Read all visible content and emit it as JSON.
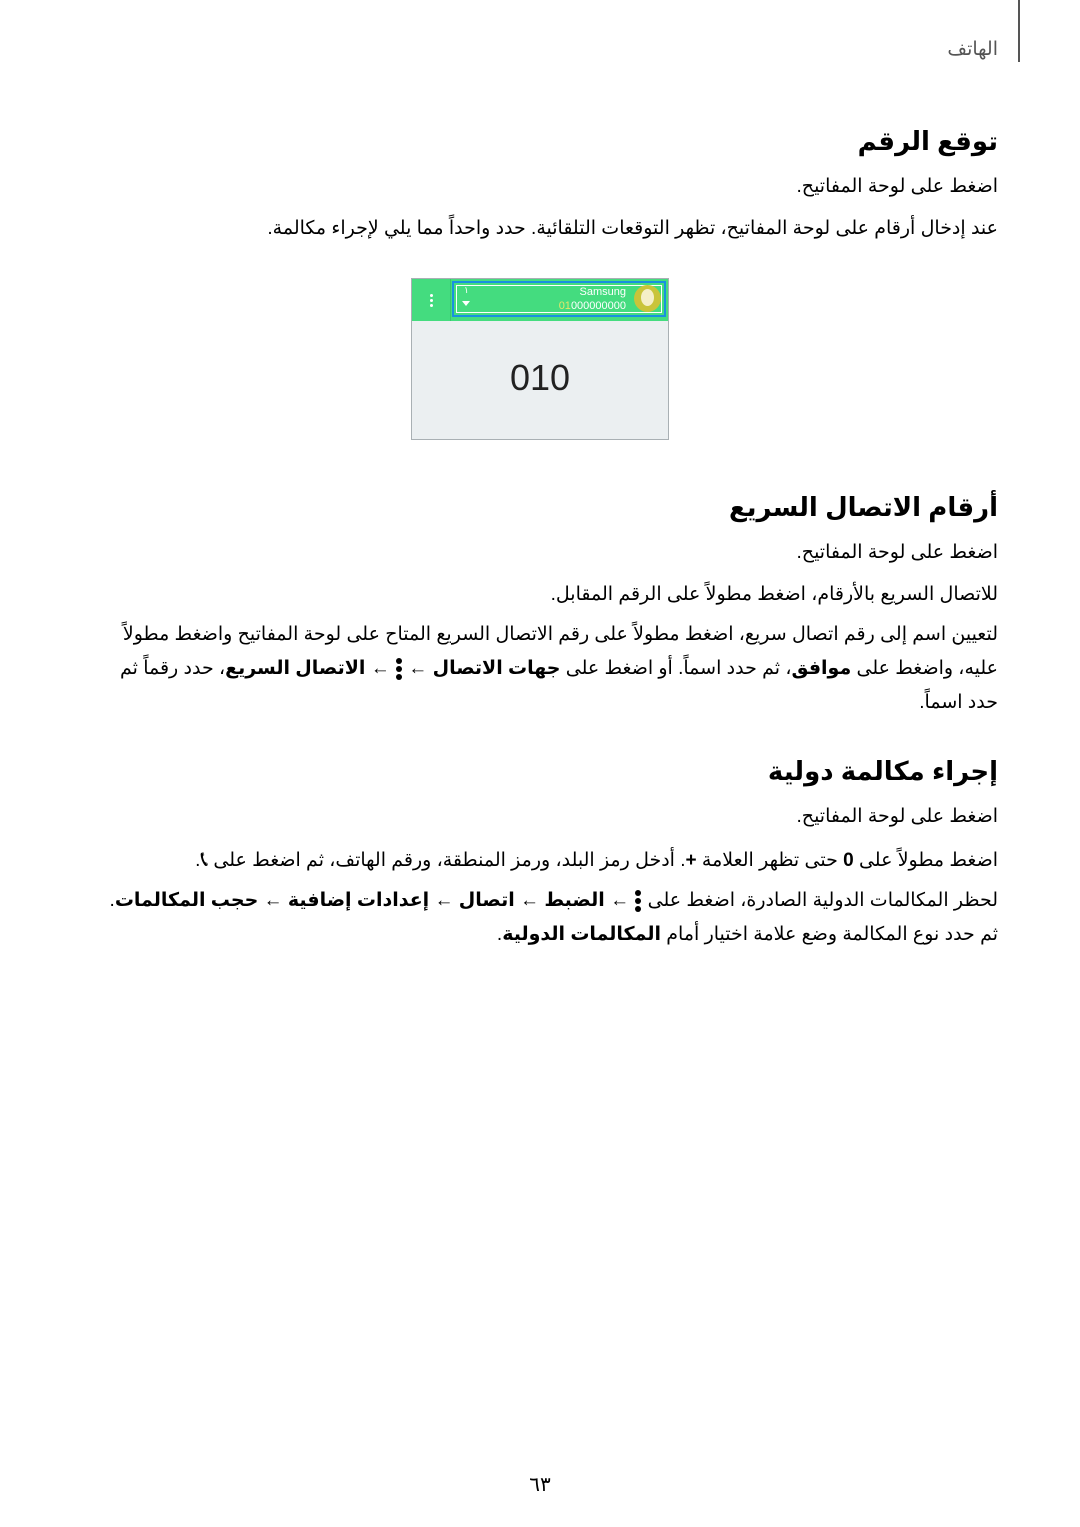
{
  "header": {
    "chapter": "الهاتف"
  },
  "sections": [
    {
      "title": "توقع الرقم",
      "step": "اضغط على لوحة المفاتيح.",
      "para": "عند إدخال أرقام على لوحة المفاتيح، تظهر التوقعات التلقائية. حدد واحداً مما يلي لإجراء مكالمة."
    },
    {
      "title": "أرقام الاتصال السريع",
      "step": "اضغط على لوحة المفاتيح.",
      "para1": "للاتصال السريع بالأرقام، اضغط مطولاً على الرقم المقابل.",
      "para2": {
        "s1": "لتعيين اسم إلى رقم اتصال سريع، اضغط مطولاً على رقم الاتصال السريع المتاح على لوحة المفاتيح واضغط مطولاً عليه، واضغط على ",
        "b1": "موافق",
        "s2": "، ثم حدد اسماً. أو اضغط على ",
        "b2": "جهات الاتصال",
        "arrow": " ← ",
        "b3": "الاتصال السريع",
        "s3": "، حدد رقماً ثم حدد اسماً."
      }
    },
    {
      "title": "إجراء مكالمة دولية",
      "step": "اضغط على لوحة المفاتيح.",
      "para1": {
        "s1": "اضغط مطولاً على ",
        "b1": "0",
        "s2": " حتى تظهر العلامة ",
        "b2": "+",
        "s3": ". أدخل رمز البلد، ورمز المنطقة، ورقم الهاتف، ثم اضغط على ",
        "s4": "."
      },
      "para2": {
        "s1": "لحظر المكالمات الدولية الصادرة، اضغط على ",
        "arrow": " ← ",
        "b1": "الضبط",
        "b2": "اتصال",
        "b3": "إعدادات إضافية",
        "b4": "حجب المكالمات",
        "s2": ". ثم حدد نوع المكالمة وضع علامة اختيار أمام ",
        "b5": "المكالمات الدولية",
        "s3": "."
      }
    }
  ],
  "phone": {
    "sim": "١",
    "contact_name": "Samsung",
    "number_match": "01",
    "number_rest": "000000000",
    "display": "010",
    "colors": {
      "bar": "#44dc7f",
      "highlight": "#1a8fe0",
      "match": "#e5e76a"
    }
  },
  "icons": {
    "menu": "more-vertical-icon",
    "call": "phone-icon"
  },
  "page_number": "٦٣"
}
